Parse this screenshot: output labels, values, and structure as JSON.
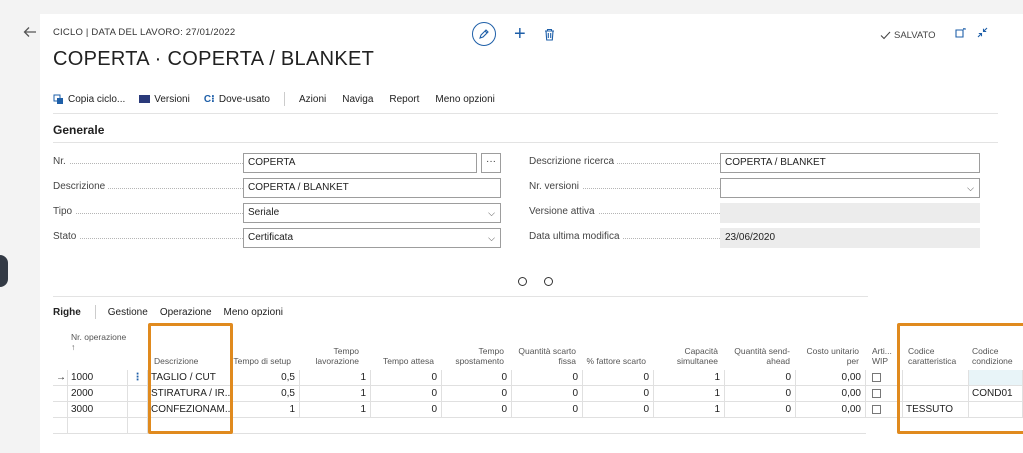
{
  "header": {
    "breadcrumb": "CICLO | DATA DEL LAVORO: 27/01/2022",
    "title": "COPERTA · COPERTA / BLANKET",
    "saved_label": "SALVATO"
  },
  "toolbar": {
    "copy": "Copia ciclo...",
    "versions": "Versioni",
    "where_used": "Dove-usato",
    "actions": "Azioni",
    "navigate": "Naviga",
    "report": "Report",
    "less": "Meno opzioni"
  },
  "general": {
    "title": "Generale",
    "nr_label": "Nr.",
    "nr_value": "COPERTA",
    "desc_label": "Descrizione",
    "desc_value": "COPERTA / BLANKET",
    "type_label": "Tipo",
    "type_value": "Seriale",
    "status_label": "Stato",
    "status_value": "Certificata",
    "search_label": "Descrizione ricerca",
    "search_value": "COPERTA / BLANKET",
    "versions_label": "Nr. versioni",
    "versions_value": "",
    "active_label": "Versione attiva",
    "active_value": "",
    "modified_label": "Data ultima modifica",
    "modified_value": "23/06/2020",
    "ellipsis": "···"
  },
  "lines": {
    "title": "Righe",
    "tabs": [
      "Gestione",
      "Operazione",
      "Meno opzioni"
    ],
    "headers": {
      "op": "Nr. operazione ↑",
      "desc": "Descrizione",
      "setup": "Tempo di setup",
      "work": "Tempo lavorazione",
      "wait": "Tempo attesa",
      "move": "Tempo spostamento",
      "scrap_qty": "Quantità scarto fissa",
      "scrap_pct": "% fattore scarto",
      "capacity": "Capacità simultanee",
      "send_ahead": "Quantità send-ahead",
      "unit_cost": "Costo unitario per",
      "wip": "Arti... WIP",
      "feature": "Codice caratteristica",
      "condition": "Codice condizione"
    },
    "rows": [
      {
        "arrow": "→",
        "op": "1000",
        "menu": "⋮",
        "desc": "TAGLIO / CUT",
        "setup": "0,5",
        "work": "1",
        "wait": "0",
        "move": "0",
        "scrap_qty": "0",
        "scrap_pct": "0",
        "capacity": "1",
        "send_ahead": "0",
        "unit_cost": "0,00",
        "feature": "",
        "condition": ""
      },
      {
        "arrow": "",
        "op": "2000",
        "menu": "",
        "desc": "STIRATURA / IR...",
        "setup": "0,5",
        "work": "1",
        "wait": "0",
        "move": "0",
        "scrap_qty": "0",
        "scrap_pct": "0",
        "capacity": "1",
        "send_ahead": "0",
        "unit_cost": "0,00",
        "feature": "",
        "condition": "COND01"
      },
      {
        "arrow": "",
        "op": "3000",
        "menu": "",
        "desc": "CONFEZIONAM...",
        "setup": "1",
        "work": "1",
        "wait": "0",
        "move": "0",
        "scrap_qty": "0",
        "scrap_pct": "0",
        "capacity": "1",
        "send_ahead": "0",
        "unit_cost": "0,00",
        "feature": "TESSUTO",
        "condition": ""
      }
    ]
  },
  "colors": {
    "accent": "#1e5fa8",
    "highlight": "#e08a1e"
  }
}
